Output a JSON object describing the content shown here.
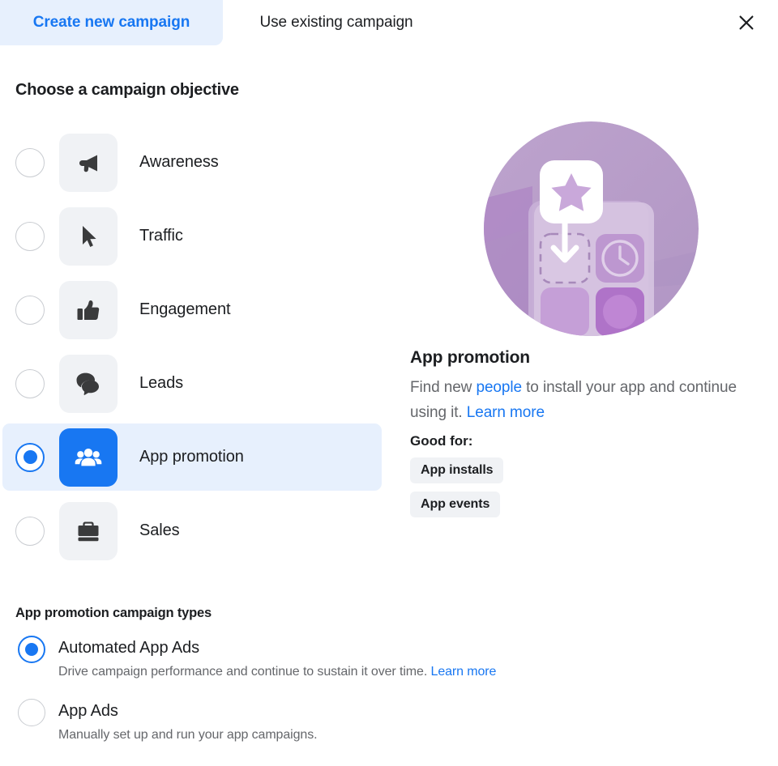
{
  "tabs": [
    {
      "label": "Create new campaign",
      "active": true,
      "name": "tab-create-new-campaign"
    },
    {
      "label": "Use existing campaign",
      "active": false,
      "name": "tab-use-existing-campaign"
    }
  ],
  "close_icon": "close-icon",
  "objective": {
    "heading": "Choose a campaign objective",
    "items": [
      {
        "label": "Awareness",
        "icon": "megaphone-icon",
        "selected": false
      },
      {
        "label": "Traffic",
        "icon": "cursor-icon",
        "selected": false
      },
      {
        "label": "Engagement",
        "icon": "thumbs-up-icon",
        "selected": false
      },
      {
        "label": "Leads",
        "icon": "chat-bubble-icon",
        "selected": false
      },
      {
        "label": "App promotion",
        "icon": "people-icon",
        "selected": true
      },
      {
        "label": "Sales",
        "icon": "briefcase-icon",
        "selected": false
      }
    ]
  },
  "detail": {
    "illustration": "app-promotion-illustration",
    "title": "App promotion",
    "desc_part1": "Find new ",
    "desc_link1": "people",
    "desc_part2": " to install your app and continue using it. ",
    "desc_link2": "Learn more",
    "good_for_label": "Good for:",
    "chips": [
      "App installs",
      "App events"
    ]
  },
  "campaign_types": {
    "heading": "App promotion campaign types",
    "options": [
      {
        "label": "Automated App Ads",
        "desc": "Drive campaign performance and continue to sustain it over time. ",
        "link": "Learn more",
        "selected": true
      },
      {
        "label": "App Ads",
        "desc": "Manually set up and run your app campaigns.",
        "link": "",
        "selected": false
      }
    ]
  },
  "colors": {
    "accent": "#1877f2",
    "accent_soft": "#e7f0fd",
    "tile": "#f0f2f5",
    "text": "#1c1e21",
    "muted": "#65676b",
    "illustration_purple": "#b79cc8",
    "illustration_purple_dark": "#a07cb6"
  }
}
